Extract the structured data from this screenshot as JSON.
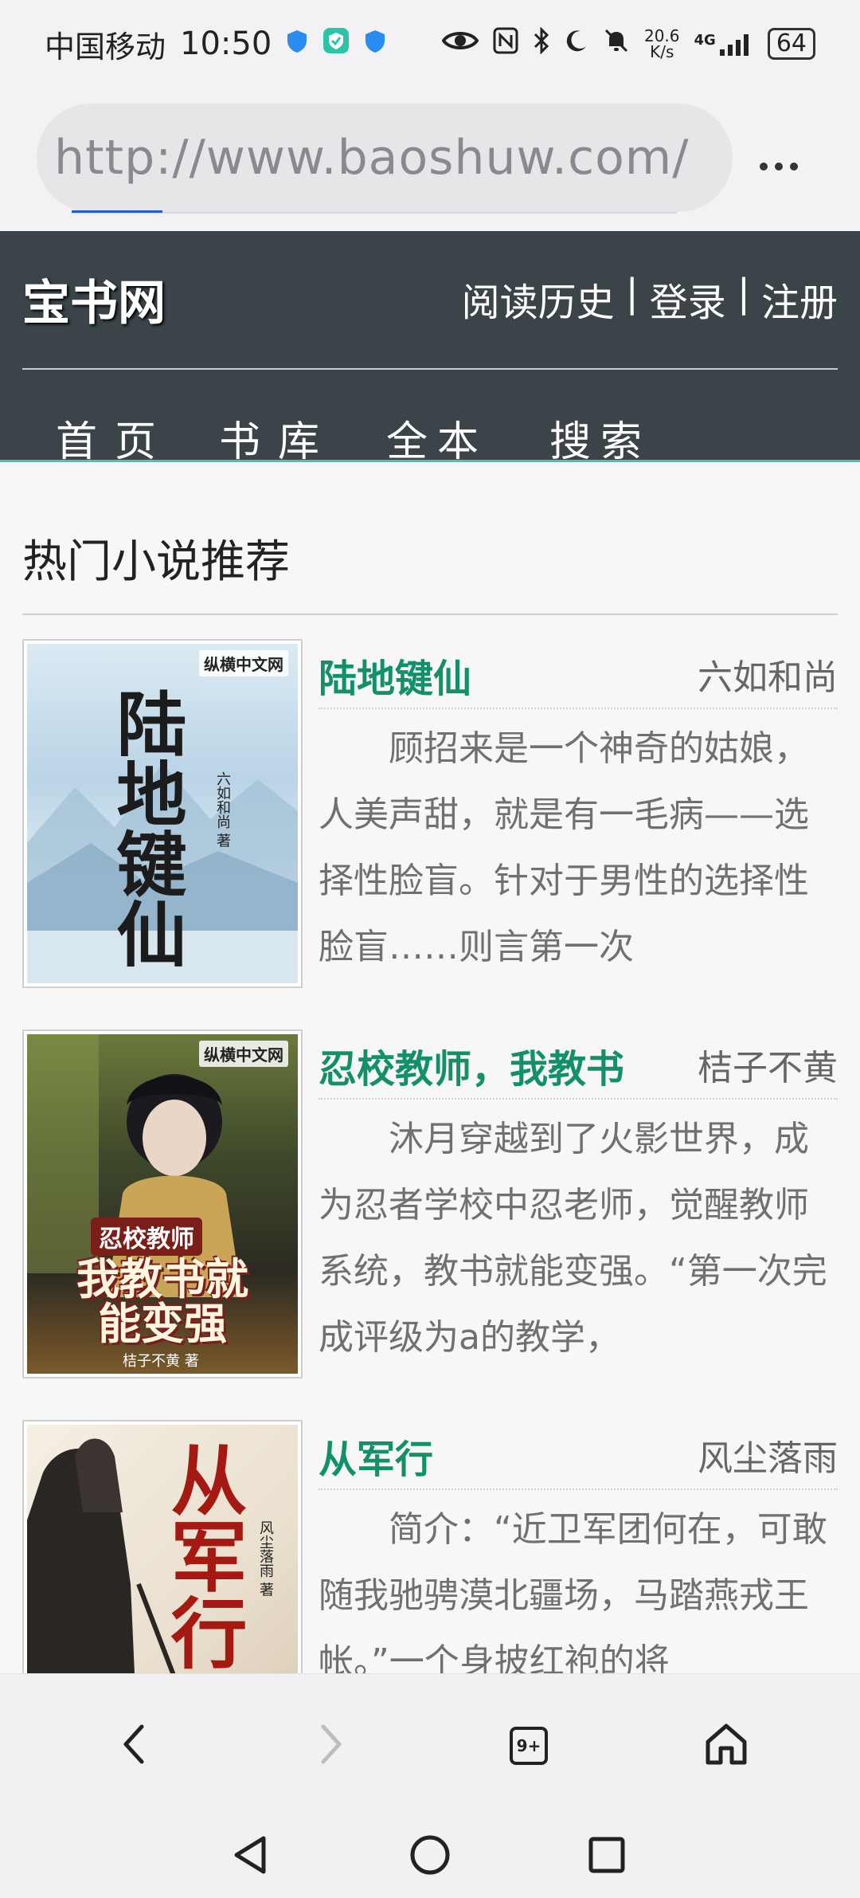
{
  "status_bar": {
    "carrier": "中国移动",
    "time": "10:50",
    "net_speed_value": "20.6",
    "net_speed_unit": "K/s",
    "network": "4G",
    "battery": "64"
  },
  "browser": {
    "url": "http://www.baoshuw.com/",
    "load_progress_percent": 15
  },
  "site": {
    "logo": "宝书网",
    "links": [
      "阅读历史",
      "|",
      "登录",
      "|",
      "注册"
    ],
    "nav": [
      "首页",
      "书库",
      "全本",
      "搜索"
    ]
  },
  "section": {
    "title": "热门小说推荐"
  },
  "books": [
    {
      "title": "陆地键仙",
      "author": "六如和尚",
      "description": "顾招来是一个神奇的姑娘，人美声甜，就是有一毛病——选择性脸盲。针对于男性的选择性脸盲……则言第一次",
      "cover_title": "陆地键仙",
      "cover_brand": "纵横中文网",
      "cover_author": "六如和尚 著"
    },
    {
      "title": "忍校教师，我教书",
      "author": "桔子不黄",
      "description": "沐月穿越到了火影世界，成为忍者学校中忍老师，觉醒教师系统，教书就能变强。“第一次完成评级为a的教学，",
      "cover_title_top": "忍校教师",
      "cover_title_main": "我教书就能变强",
      "cover_brand": "纵横中文网",
      "cover_author": "桔子不黄 著"
    },
    {
      "title": "从军行",
      "author": "风尘落雨",
      "description": "简介：“近卫军团何在，可敢随我驰骋漠北疆场，马踏燕戎王帐。”一个身披红袍的将",
      "cover_title": "从军行",
      "cover_author": "风尘落雨 著"
    }
  ],
  "toolbar": {
    "tab_count": "9+"
  }
}
